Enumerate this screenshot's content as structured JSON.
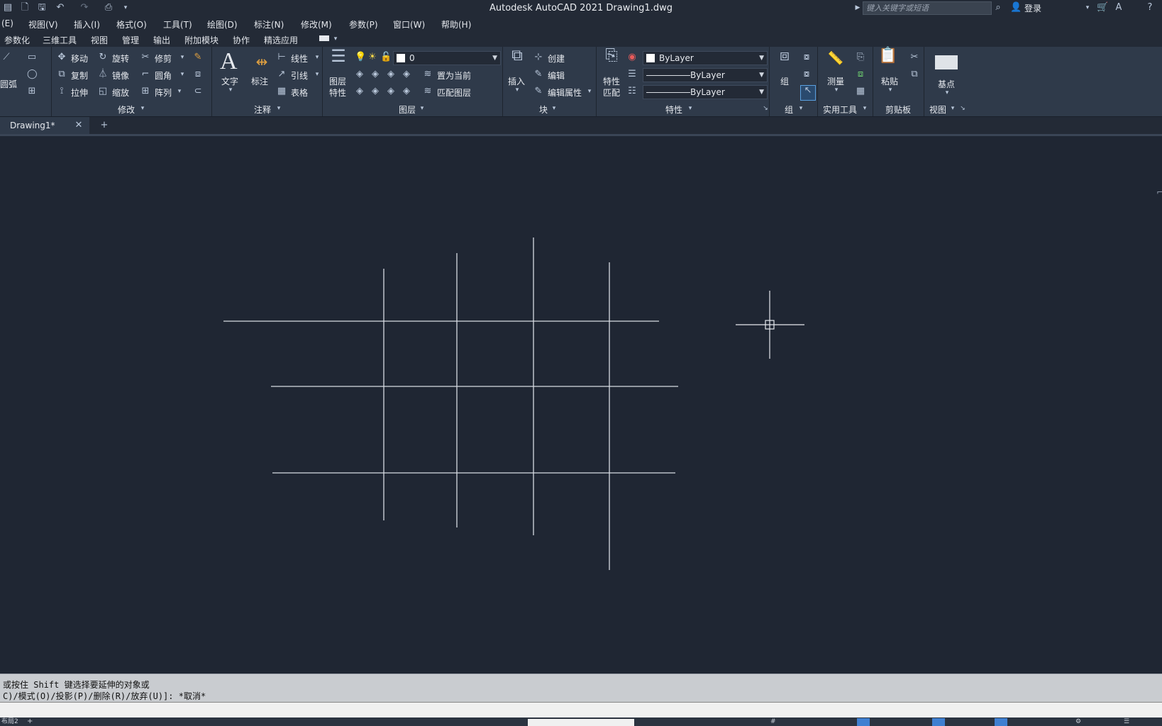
{
  "window": {
    "title": "Autodesk AutoCAD 2021    Drawing1.dwg"
  },
  "search": {
    "placeholder": "键入关键字或短语"
  },
  "account": {
    "login": "登录"
  },
  "menu": [
    "(E)",
    "视图(V)",
    "插入(I)",
    "格式(O)",
    "工具(T)",
    "绘图(D)",
    "标注(N)",
    "修改(M)",
    "参数(P)",
    "窗口(W)",
    "帮助(H)"
  ],
  "ribbon_tabs": [
    "参数化",
    "三维工具",
    "视图",
    "管理",
    "输出",
    "附加模块",
    "协作",
    "精选应用"
  ],
  "ribbon": {
    "draw": {
      "arc": "圆弧"
    },
    "modify": {
      "title": "修改",
      "move": "移动",
      "rotate": "旋转",
      "trim": "修剪",
      "copy": "复制",
      "mirror": "镜像",
      "fillet": "圆角",
      "stretch": "拉伸",
      "scale": "缩放",
      "array": "阵列"
    },
    "annotation": {
      "title": "注释",
      "text": "文字",
      "dimension": "标注",
      "linear": "线性",
      "leader": "引线",
      "table": "表格"
    },
    "layers": {
      "title": "图层",
      "properties_1": "图层",
      "properties_2": "特性",
      "layer_value": "0",
      "set_current": "置为当前",
      "match_layer": "匹配图层"
    },
    "block": {
      "title": "块",
      "insert": "插入",
      "create": "创建",
      "edit": "编辑",
      "edit_attr": "编辑属性"
    },
    "properties": {
      "title": "特性",
      "match_1": "特性",
      "match_2": "匹配",
      "color": "ByLayer",
      "linetype": "ByLayer",
      "lineweight": "ByLayer"
    },
    "groups": {
      "title": "组",
      "group": "组"
    },
    "utilities": {
      "title": "实用工具",
      "measure": "测量"
    },
    "clipboard": {
      "title": "剪贴板",
      "paste": "粘贴"
    },
    "view": {
      "title": "视图",
      "base": "基点"
    }
  },
  "doc_tabs": [
    {
      "label": "Drawing1*"
    }
  ],
  "command": {
    "line1": "或按住 Shift 键选择要延伸的对象或",
    "line2": "C)/模式(O)/投影(P)/删除(R)/放弃(U)]: *取消*"
  },
  "status": {
    "model_tab": "布局2"
  },
  "colors": {
    "canvas": "#1f2633",
    "ribbon": "#2f3a4a",
    "line": "#d8dce3"
  }
}
